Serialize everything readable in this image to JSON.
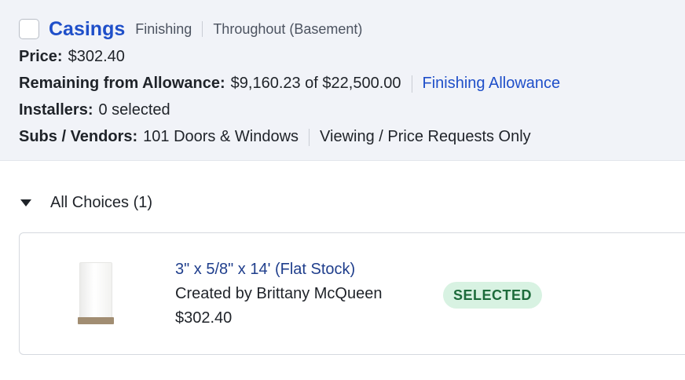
{
  "item": {
    "title": "Casings",
    "category": "Finishing",
    "location": "Throughout (Basement)",
    "price_label": "Price:",
    "price": "$302.40",
    "remaining_label": "Remaining from Allowance:",
    "remaining_value": "$9,160.23 of $22,500.00",
    "allowance_link": "Finishing Allowance",
    "installers_label": "Installers:",
    "installers_value": "0 selected",
    "subs_label": "Subs / Vendors:",
    "subs_value": "101 Doors & Windows",
    "subs_access": "Viewing / Price Requests Only"
  },
  "choices": {
    "header": "All Choices (1)",
    "list": [
      {
        "name": "3\" x 5/8\" x 14' (Flat Stock)",
        "created_by": "Created by Brittany McQueen",
        "price": "$302.40",
        "status": "SELECTED",
        "status_color": "#d8f2e2"
      }
    ]
  },
  "colors": {
    "accent": "#1f4fc9",
    "header_bg": "#f1f3f8"
  }
}
